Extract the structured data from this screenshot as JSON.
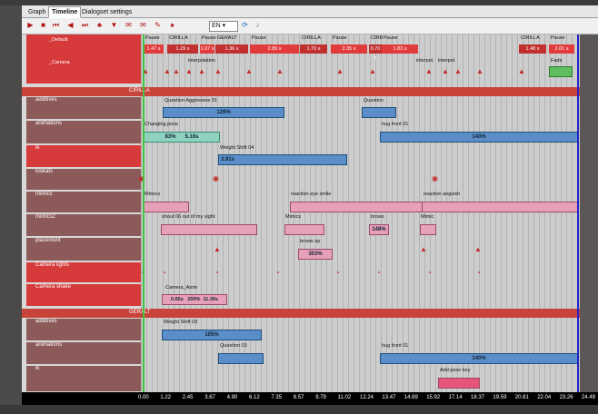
{
  "tabs": [
    "Graph",
    "Timeline",
    "Dialogset settings"
  ],
  "toolbar": {
    "language": "EN"
  },
  "groups": {
    "cirilla": "CIRILLA",
    "geralt": "GERALT"
  },
  "tracks": {
    "default": "_Default",
    "camera": "_Camera",
    "additives": "additives",
    "animations": "animations",
    "ik": "ik",
    "lookats": "lookats",
    "mimics": "mimics",
    "mimics2": "mimics2",
    "placement": "placement",
    "camera_lights": "Camera lights",
    "camera_shake": "Camera shake",
    "g_additives": "additives",
    "g_animations": "animations",
    "g_ik": "ik"
  },
  "default_blocks": [
    {
      "label": "Pause",
      "val": "1.47 s"
    },
    {
      "label": "CIRILLA",
      "val": "1.29 s"
    },
    {
      "label": "Pause",
      "val": "1.07 s"
    },
    {
      "label": "GERALT",
      "val": "1.36 s"
    },
    {
      "label": "Pause",
      "val": "2.89 s"
    },
    {
      "label": "CIRILLA",
      "val": "1.70 s"
    },
    {
      "label": "Pause",
      "val": "2.35 s"
    },
    {
      "label": "CIRB",
      "val": "0.70 s"
    },
    {
      "label": "Pause",
      "val": "1.83 s"
    },
    {
      "label": "CIRILLA",
      "val": "1.48 s"
    },
    {
      "label": "Pause",
      "val": "2.01 s"
    }
  ],
  "camera_labels": {
    "interp1": "interpolation",
    "interp2": "interpol.",
    "interp3": "interpol.",
    "fade": "Fade"
  },
  "cirilla": {
    "additives": [
      {
        "name": "Question Aggressive 01",
        "value": "126%"
      },
      {
        "name": "Question",
        "value": ""
      }
    ],
    "animations": [
      {
        "name": "Changing pose",
        "v1": "83%",
        "v2": "5.16s"
      },
      {
        "name": "hug front 01",
        "value": "140%"
      }
    ],
    "ik": [
      {
        "name": "Weight Shift 04",
        "value": "3.91s"
      }
    ],
    "mimics": [
      {
        "name": "Mimics"
      },
      {
        "name": "reaction eye smile"
      },
      {
        "name": "reaction anguish"
      }
    ],
    "mimics2": [
      {
        "name": "shout 06 out of my sight"
      },
      {
        "name": "Mimics"
      },
      {
        "name": "brows",
        "value": "148%"
      },
      {
        "name": "Mimic"
      }
    ],
    "placement": [
      {
        "name": "brows up",
        "value": "303%"
      }
    ],
    "camera_shake": [
      {
        "name": "Camera_Anim",
        "v1": "0.65s",
        "v2": "200%",
        "v3": "11.30s"
      }
    ]
  },
  "geralt": {
    "additives": [
      {
        "name": "Weight Shift 03",
        "value": "105%"
      }
    ],
    "animations": [
      {
        "name": "Question 03"
      },
      {
        "name": "hug front 01",
        "value": "140%"
      }
    ],
    "ik": [
      {
        "name": "Add pose key"
      }
    ]
  },
  "ruler": [
    "0.00",
    "1.22",
    "2.45",
    "3.67",
    "4.90",
    "6.12",
    "7.35",
    "8.57",
    "9.79",
    "11.02",
    "12.24",
    "13.47",
    "14.69",
    "15.92",
    "17.14",
    "18.37",
    "19.59",
    "20.81",
    "22.04",
    "23.26",
    "24.49"
  ]
}
